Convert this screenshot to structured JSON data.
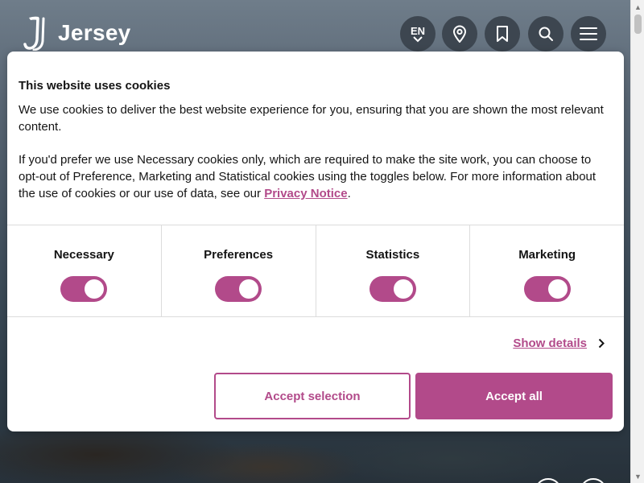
{
  "header": {
    "brand": "Jersey",
    "language": "EN",
    "buttons": {
      "language": "chevron-down-icon",
      "map": "location-pin-icon",
      "saved": "bookmark-icon",
      "search": "search-icon",
      "menu": "hamburger-menu-icon"
    }
  },
  "cookie_banner": {
    "title": "This website uses cookies",
    "paragraph1": "We use cookies to deliver the best website experience for you, ensuring that you are shown the most relevant content.",
    "paragraph2_prefix": "If you'd prefer we use Necessary cookies only, which are required to make the site work, you can choose to opt-out of Preference, Marketing and Statistical cookies using the toggles below. For more information about the use of cookies or our use of data, see our ",
    "privacy_link": "Privacy Notice",
    "paragraph2_suffix": ".",
    "toggles": [
      {
        "label": "Necessary",
        "on": true
      },
      {
        "label": "Preferences",
        "on": true
      },
      {
        "label": "Statistics",
        "on": true
      },
      {
        "label": "Marketing",
        "on": true
      }
    ],
    "show_details": "Show details",
    "accept_selection": "Accept selection",
    "accept_all": "Accept all"
  },
  "colors": {
    "accent": "#b24a8a",
    "header_button": "#3d4650",
    "text": "#141414"
  }
}
